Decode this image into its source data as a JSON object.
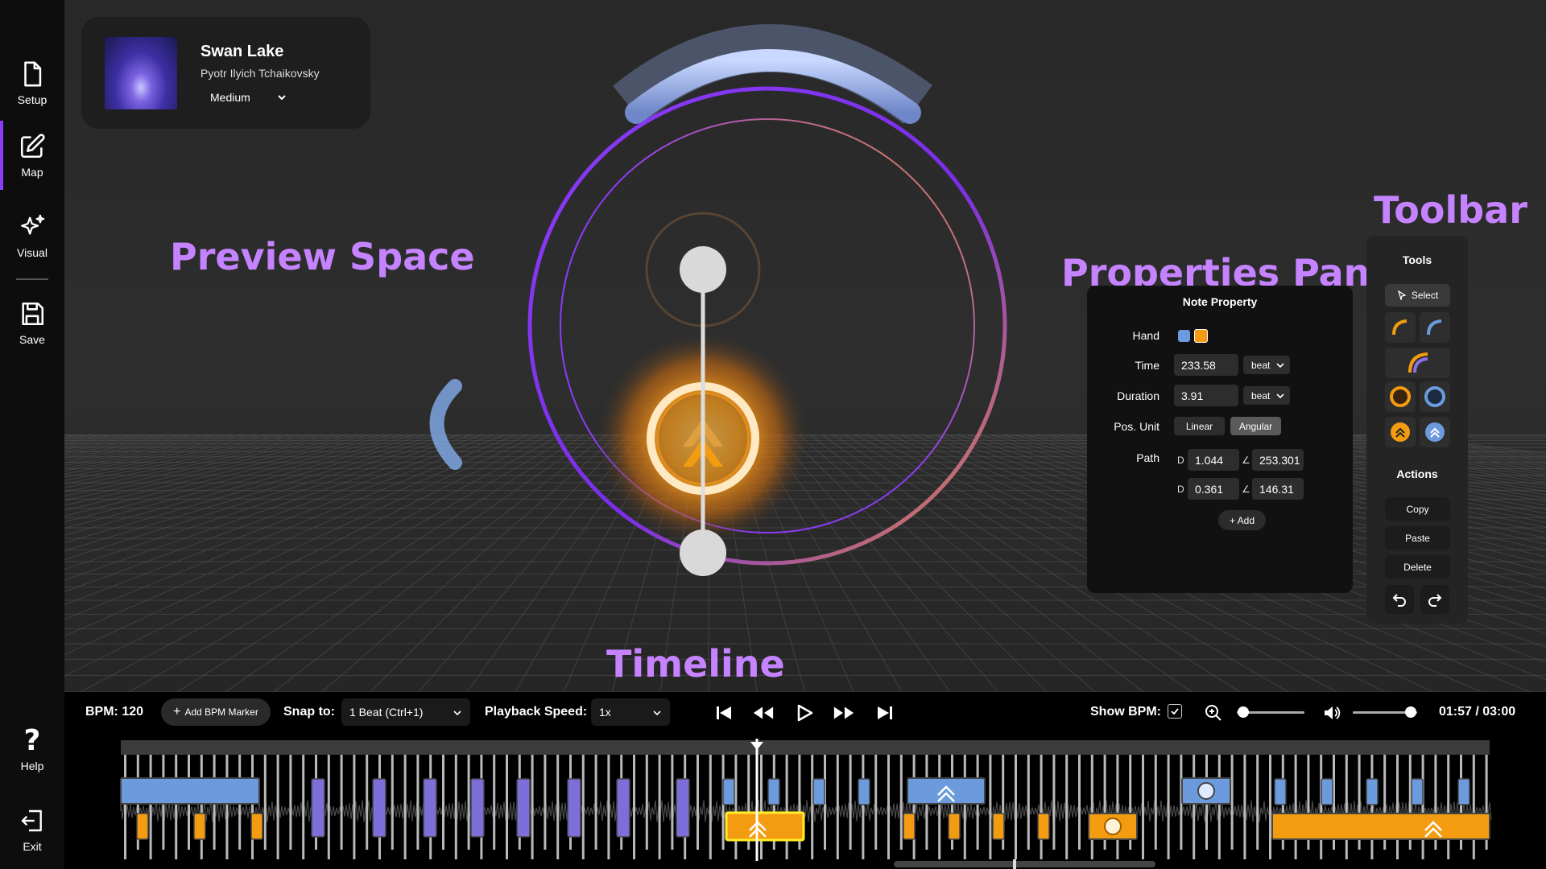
{
  "sidebar": {
    "items": [
      {
        "label": "Setup",
        "icon": "file-icon"
      },
      {
        "label": "Map",
        "icon": "edit-icon",
        "active": true
      },
      {
        "label": "Visual",
        "icon": "sparkles-icon"
      },
      {
        "label": "Save",
        "icon": "floppy-disk-icon"
      }
    ],
    "help_label": "Help",
    "exit_label": "Exit"
  },
  "song": {
    "title": "Swan Lake",
    "artist": "Pyotr Ilyich Tchaikovsky",
    "difficulty": "Medium"
  },
  "overlays": {
    "preview_space": "Preview Space",
    "properties_panel": "Properties Panel",
    "toolbar": "Toolbar",
    "timeline": "Timeline"
  },
  "properties": {
    "title": "Note Property",
    "hand_label": "Hand",
    "hand_colors": [
      "#6b9bdc",
      "#f39c12"
    ],
    "time_label": "Time",
    "time_value": "233.58",
    "time_unit": "beat",
    "duration_label": "Duration",
    "duration_value": "3.91",
    "duration_unit": "beat",
    "pos_unit_label": "Pos. Unit",
    "pos_unit_options": [
      "Linear",
      "Angular"
    ],
    "pos_unit_selected": "Angular",
    "path_label": "Path",
    "path_rows": [
      {
        "d_label": "D",
        "d_value": "1.044",
        "angle_label": "∠",
        "angle_value": "253.301"
      },
      {
        "d_label": "D",
        "d_value": "0.361",
        "angle_label": "∠",
        "angle_value": "146.31"
      }
    ],
    "add_label": "+ Add"
  },
  "toolbar": {
    "tools_heading": "Tools",
    "select_label": "Select",
    "actions_heading": "Actions",
    "copy_label": "Copy",
    "paste_label": "Paste",
    "delete_label": "Delete"
  },
  "controls": {
    "bpm_text": "BPM: 120",
    "add_bpm_marker": "Add BPM Marker",
    "snap_label": "Snap to:",
    "snap_value": "1 Beat (Ctrl+1)",
    "playback_label": "Playback Speed:",
    "playback_value": "1x",
    "show_bpm_label": "Show BPM:",
    "show_bpm_checked": true,
    "zoom_level": 0.1,
    "volume_level": 0.9,
    "time_display": "01:57 / 03:00"
  },
  "colors": {
    "accent_purple": "#8b3cf7",
    "label_purple": "#c583ff",
    "left_hand_blue": "#6b9bdc",
    "right_hand_orange": "#f39c12",
    "note_purple": "#7c6fd9"
  }
}
